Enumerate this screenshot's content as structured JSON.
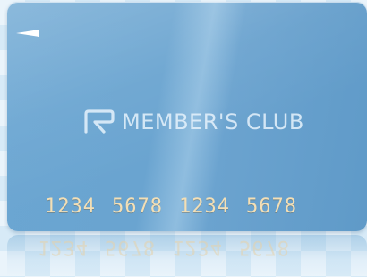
{
  "card": {
    "brand_name": "MEMBER'S CLUB",
    "number_groups": [
      "1234",
      "5678",
      "1234",
      "5678"
    ]
  },
  "icons": {
    "logo": "member-club-logo-icon",
    "arrow": "arrow-left-icon"
  },
  "colors": {
    "card_blue": "#6aa4d0",
    "number_gold": "#f3dfb6"
  }
}
